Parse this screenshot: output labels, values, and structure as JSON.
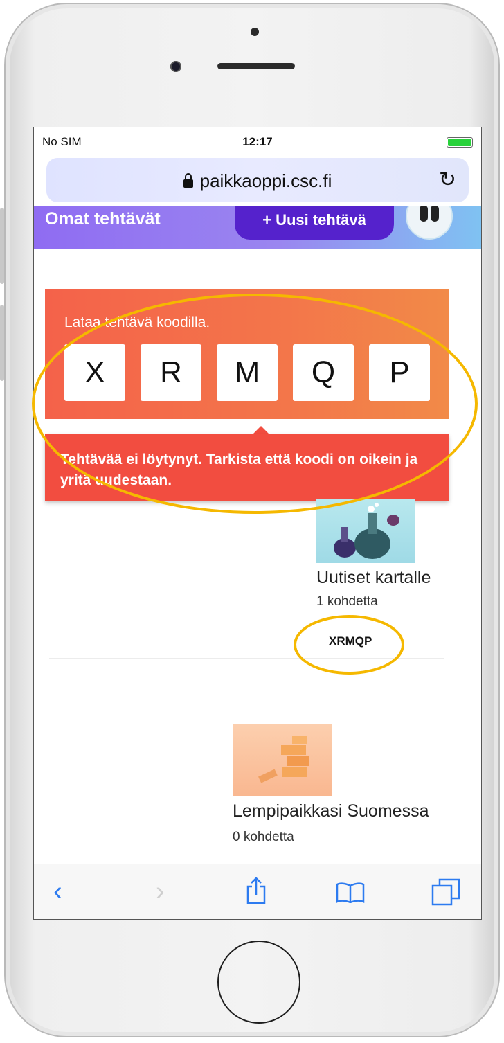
{
  "status_bar": {
    "carrier": "No SIM",
    "time": "12:17"
  },
  "browser": {
    "url": "paikkaoppi.csc.fi",
    "reload_icon": "reload-icon"
  },
  "app_header": {
    "title": "Omat tehtävät",
    "new_task_label": "+ Uusi tehtävä"
  },
  "code_entry": {
    "label": "Lataa tehtävä koodilla.",
    "letters": [
      "X",
      "R",
      "M",
      "Q",
      "P"
    ]
  },
  "error": {
    "message": "Tehtävää ei löytynyt. Tarkista että koodi on oikein ja yritä uudestaan."
  },
  "tasks": [
    {
      "title": "Uutiset kartalle",
      "count": "1 kohdetta",
      "code": "XRMQP"
    },
    {
      "title": "Lempipaikkasi Suomessa",
      "count": "0 kohdetta"
    }
  ],
  "toolbar": {
    "back_icon": "back-icon",
    "forward_icon": "forward-icon",
    "share_icon": "share-icon",
    "bookmarks_icon": "bookmarks-icon",
    "tabs_icon": "tabs-icon"
  },
  "colors": {
    "accent_button": "#5522cc",
    "code_panel": "#f3764a",
    "error": "#f24d40",
    "annotation": "#f5b800",
    "ios_blue": "#2d7bf0"
  }
}
